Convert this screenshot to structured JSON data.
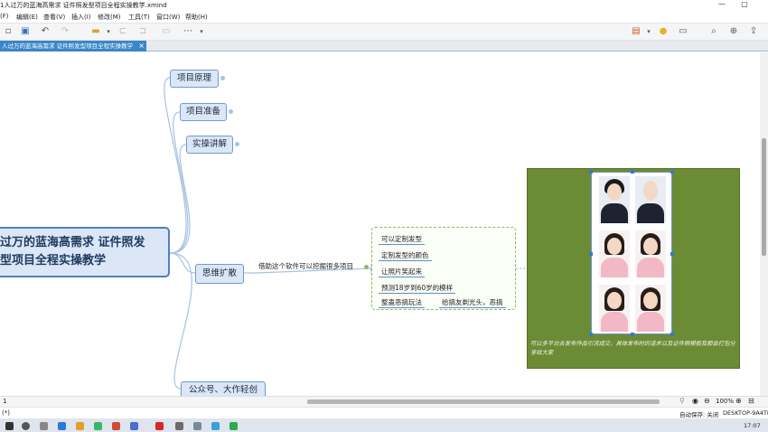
{
  "window": {
    "title": "1人过万的蓝海高需求 证件照发型项目全程实操教学.xmind",
    "minimize": "—",
    "maximize": "▢"
  },
  "menu": [
    "(F)",
    "编辑(E)",
    "查看(V)",
    "插入(I)",
    "修改(M)",
    "工具(T)",
    "窗口(W)",
    "帮助(H)"
  ],
  "toolbar": {
    "more": "⋯"
  },
  "tab": {
    "label": "人过万的蓝海高需求 证件照发型项目全程实操教学",
    "close": "×"
  },
  "mindmap": {
    "root_line1": "过万的蓝海高需求 证件照发",
    "root_line2": "型项目全程实操教学",
    "branches": [
      "项目原理",
      "项目准备",
      "实操讲解",
      "思维扩散",
      "公众号、大作轻创"
    ],
    "expand_label": "借助这个软件可以挖掘很多项目",
    "sub_items": [
      "可以定制发型",
      "定制发型的颜色",
      "让照片笑起来",
      "预测18岁到60岁的模样",
      "整蛊恶搞玩法"
    ],
    "sub_extra": "给搞友剃光头，恶搞",
    "image_caption": "可以多平台去发布作品引流成交，具体发布时的话术以及证件照模板我都会打包分享给大家"
  },
  "bottom": {
    "page": "1",
    "zoom": "100%"
  },
  "status": {
    "left": "(*)",
    "autosave": "自动保存: 关闭",
    "computer": "DESKTOP-9A4TB",
    "time": "17:07"
  },
  "colors": {
    "accent": "#3a86c8",
    "node_fill": "#dbe7f6",
    "node_border": "#6e9cd2",
    "image_bg": "#6b8b34"
  }
}
